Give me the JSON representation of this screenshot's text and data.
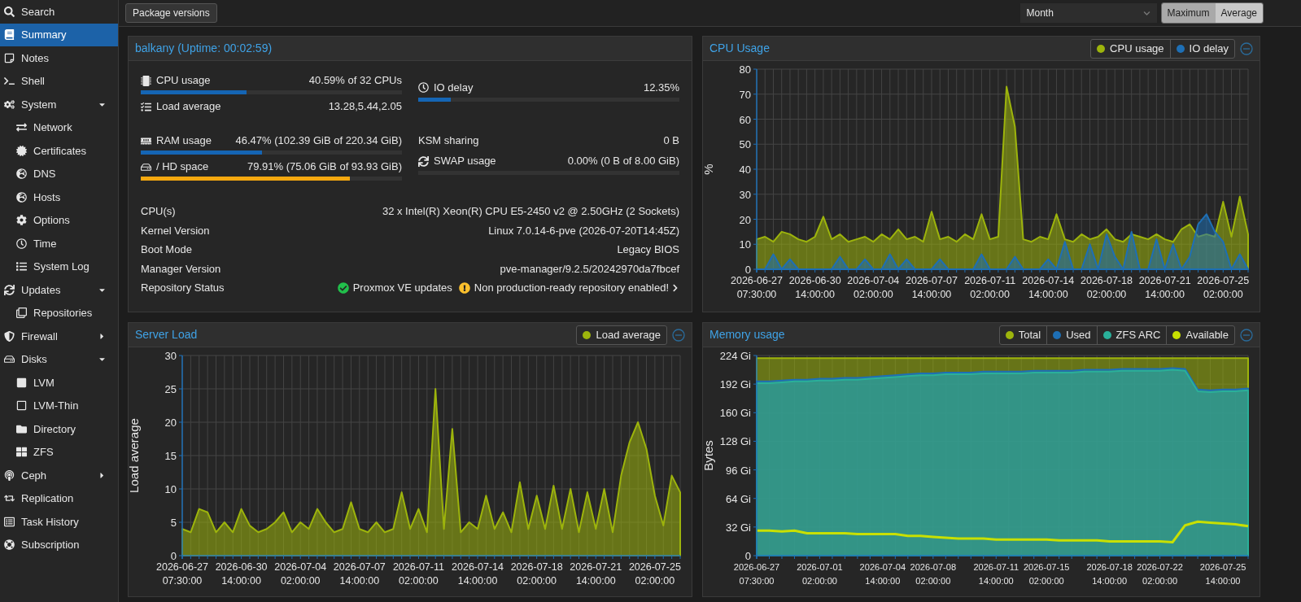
{
  "toolbar": {
    "package_button": "Package versions",
    "timeframe": "Month",
    "modes": [
      {
        "label": "Maximum",
        "selected": true
      },
      {
        "label": "Average",
        "selected": false
      }
    ]
  },
  "sidebar": {
    "items": [
      {
        "label": "Search",
        "selected": false
      },
      {
        "label": "Summary",
        "selected": true
      },
      {
        "label": "Notes",
        "selected": false
      },
      {
        "label": "Shell",
        "selected": false
      },
      {
        "label": "System",
        "selected": false,
        "expanded": true,
        "children": [
          {
            "label": "Network",
            "selected": false
          },
          {
            "label": "Certificates",
            "selected": false
          },
          {
            "label": "DNS",
            "selected": false
          },
          {
            "label": "Hosts",
            "selected": false
          },
          {
            "label": "Options",
            "selected": false
          },
          {
            "label": "Time",
            "selected": false
          },
          {
            "label": "System Log",
            "selected": false
          }
        ]
      },
      {
        "label": "Updates",
        "selected": false,
        "expanded": true,
        "children": [
          {
            "label": "Repositories",
            "selected": false
          }
        ]
      },
      {
        "label": "Firewall",
        "selected": false,
        "expanded": false
      },
      {
        "label": "Disks",
        "selected": false,
        "expanded": true,
        "children": [
          {
            "label": "LVM",
            "selected": false
          },
          {
            "label": "LVM-Thin",
            "selected": false
          },
          {
            "label": "Directory",
            "selected": false
          },
          {
            "label": "ZFS",
            "selected": false
          }
        ]
      },
      {
        "label": "Ceph",
        "selected": false,
        "expanded": false
      },
      {
        "label": "Replication",
        "selected": false
      },
      {
        "label": "Task History",
        "selected": false
      },
      {
        "label": "Subscription",
        "selected": false
      }
    ]
  },
  "summary": {
    "title": "balkany (Uptime: 00:02:59)",
    "metric_groups": [
      {
        "left": [
          {
            "kind": "bar",
            "label": "CPU usage",
            "value": "40.59% of 32 CPUs",
            "level": 0.4059,
            "warning": false
          },
          {
            "kind": "text",
            "label": "Load average",
            "value": "13.28,5.44,2.05"
          }
        ],
        "right": [
          {
            "kind": "bar",
            "label": "IO delay",
            "value": "12.35%",
            "level": 0.1235,
            "warning": false
          }
        ]
      },
      {
        "left": [
          {
            "kind": "bar",
            "label": "RAM usage",
            "value": "46.47% (102.39 GiB of 220.34 GiB)",
            "level": 0.4647,
            "warning": false
          },
          {
            "kind": "bar",
            "label": "/ HD space",
            "value": "79.91% (75.06 GiB of 93.93 GiB)",
            "level": 0.7991,
            "warning": true
          }
        ],
        "right": [
          {
            "kind": "text",
            "label": "KSM sharing",
            "value": "0 B"
          },
          {
            "kind": "bar",
            "label": "SWAP usage",
            "value": "0.00% (0 B of 8.00 GiB)"
          }
        ]
      }
    ],
    "info": [
      {
        "label": "CPU(s)",
        "value": "32 x Intel(R) Xeon(R) CPU E5-2450 v2 @ 2.50GHz (2 Sockets)"
      },
      {
        "label": "Kernel Version",
        "value": "Linux 7.0.14-6-pve (2026-07-20T14:45Z)"
      },
      {
        "label": "Boot Mode",
        "value": "Legacy BIOS"
      },
      {
        "label": "Manager Version",
        "value": "pve-manager/9.2.5/20242970da7fbcef"
      }
    ],
    "repository_status": {
      "label": "Repository Status",
      "entries": [
        {
          "kind": "ok",
          "text": "Proxmox VE updates"
        },
        {
          "kind": "warning",
          "text": "Non production-ready repository enabled!"
        }
      ]
    }
  },
  "cpu_panel": {
    "title": "CPU Usage",
    "chart_data": {
      "type": "area",
      "grid": true,
      "ylabel": "%",
      "ylim": [
        0,
        80
      ],
      "yticks": [
        0,
        10,
        20,
        30,
        40,
        50,
        60,
        70,
        80
      ],
      "categories": [
        "2026-06-27 07:30:00",
        null,
        null,
        null,
        null,
        null,
        null,
        "2026-06-30 14:00:00",
        null,
        null,
        null,
        null,
        null,
        null,
        "2026-07-04 02:00:00",
        null,
        null,
        null,
        null,
        null,
        null,
        "2026-07-07 14:00:00",
        null,
        null,
        null,
        null,
        null,
        null,
        "2026-07-11 02:00:00",
        null,
        null,
        null,
        null,
        null,
        null,
        "2026-07-14 14:00:00",
        null,
        null,
        null,
        null,
        null,
        null,
        "2026-07-18 02:00:00",
        null,
        null,
        null,
        null,
        null,
        null,
        "2026-07-21 14:00:00",
        null,
        null,
        null,
        null,
        null,
        null,
        "2026-07-25 02:00:00",
        null,
        null,
        null
      ],
      "series": [
        {
          "name": "CPU usage",
          "color": "#9db40c",
          "values": [
            12,
            13,
            11,
            15,
            14,
            12,
            11,
            13,
            21,
            12,
            14,
            11,
            12,
            13,
            11,
            14,
            12,
            16,
            12,
            13,
            11,
            23,
            12,
            13,
            11,
            14,
            12,
            22,
            12,
            13,
            73,
            57,
            12,
            11,
            13,
            12,
            22,
            12,
            11,
            14,
            12,
            13,
            16,
            12,
            11,
            14,
            13,
            12,
            14,
            12,
            11,
            16,
            18,
            13,
            14,
            13,
            27,
            13,
            29,
            14
          ]
        },
        {
          "name": "IO delay",
          "color": "#1e6fb5",
          "values": [
            0,
            0,
            6,
            0,
            4,
            0,
            0,
            0,
            0,
            0,
            5,
            0,
            0,
            4,
            0,
            0,
            6,
            0,
            4,
            0,
            0,
            0,
            4,
            0,
            0,
            0,
            0,
            6,
            0,
            0,
            0,
            5,
            0,
            0,
            0,
            4,
            0,
            11,
            0,
            0,
            10,
            0,
            14,
            5,
            0,
            15,
            0,
            0,
            12,
            0,
            10,
            0,
            5,
            18,
            22,
            15,
            11,
            0,
            6,
            0
          ]
        }
      ]
    }
  },
  "load_panel": {
    "title": "Server Load",
    "chart_data": {
      "type": "area",
      "grid": true,
      "ylabel": "Load average",
      "ylim": [
        0,
        30
      ],
      "yticks": [
        0,
        5,
        10,
        15,
        20,
        25,
        30
      ],
      "categories": [
        "2026-06-27 07:30:00",
        null,
        null,
        null,
        null,
        null,
        null,
        "2026-06-30 14:00:00",
        null,
        null,
        null,
        null,
        null,
        null,
        "2026-07-04 02:00:00",
        null,
        null,
        null,
        null,
        null,
        null,
        "2026-07-07 14:00:00",
        null,
        null,
        null,
        null,
        null,
        null,
        "2026-07-11 02:00:00",
        null,
        null,
        null,
        null,
        null,
        null,
        "2026-07-14 14:00:00",
        null,
        null,
        null,
        null,
        null,
        null,
        "2026-07-18 02:00:00",
        null,
        null,
        null,
        null,
        null,
        null,
        "2026-07-21 14:00:00",
        null,
        null,
        null,
        null,
        null,
        null,
        "2026-07-25 02:00:00",
        null,
        null,
        null
      ],
      "series": [
        {
          "name": "Load average",
          "color": "#9db40c",
          "values": [
            4,
            3.5,
            7,
            6.5,
            3.5,
            5,
            3.5,
            7,
            4.5,
            3.5,
            4,
            5,
            6.5,
            3.5,
            5,
            4,
            7,
            5,
            3.5,
            4,
            8,
            4,
            3.5,
            5,
            3.5,
            4,
            9.5,
            4,
            7,
            3.5,
            25,
            4,
            19,
            3.5,
            5,
            4,
            9,
            4,
            6.5,
            3.5,
            11,
            4,
            9,
            4,
            10.5,
            4,
            10,
            3.5,
            9.5,
            4,
            10,
            3.5,
            12,
            17,
            20,
            16,
            9,
            4.5,
            12,
            9.5
          ]
        }
      ]
    }
  },
  "memory_panel": {
    "title": "Memory usage",
    "chart_data": {
      "type": "area",
      "grid": true,
      "ylabel": "Bytes",
      "ylim": [
        0,
        224
      ],
      "yticks": [
        {
          "value": 0,
          "label": "0"
        },
        {
          "value": 32,
          "label": "32 Gi"
        },
        {
          "value": 64,
          "label": "64 Gi"
        },
        {
          "value": 96,
          "label": "96 Gi"
        },
        {
          "value": 128,
          "label": "128 Gi"
        },
        {
          "value": 160,
          "label": "160 Gi"
        },
        {
          "value": 192,
          "label": "192 Gi"
        },
        {
          "value": 224,
          "label": "224 Gi"
        }
      ],
      "categories": [
        "2026-06-27 07:30:00",
        null,
        null,
        null,
        null,
        "2026-07-01 02:00:00",
        null,
        null,
        null,
        null,
        "2026-07-04 14:00:00",
        null,
        null,
        null,
        "2026-07-08 02:00:00",
        null,
        null,
        null,
        null,
        "2026-07-11 14:00:00",
        null,
        null,
        null,
        "2026-07-15 02:00:00",
        null,
        null,
        null,
        null,
        "2026-07-18 14:00:00",
        null,
        null,
        null,
        "2026-07-22 02:00:00",
        null,
        null,
        null,
        null,
        "2026-07-25 14:00:00",
        null,
        null
      ],
      "series": [
        {
          "name": "Total",
          "color": "#9db40c",
          "values": [
            221,
            221,
            221,
            221,
            221,
            221,
            221,
            221,
            221,
            221,
            221,
            221,
            221,
            221,
            221,
            221,
            221,
            221,
            221,
            221,
            221,
            221,
            221,
            221,
            221,
            221,
            221,
            221,
            221,
            221,
            221,
            221,
            221,
            221,
            221,
            221,
            221,
            221,
            221,
            221
          ]
        },
        {
          "name": "Used",
          "color": "#1e6fb5",
          "values": [
            195,
            195,
            196,
            197,
            197,
            198,
            198,
            199,
            199,
            200,
            201,
            202,
            203,
            204,
            204,
            205,
            205,
            205,
            206,
            206,
            206,
            206,
            207,
            207,
            207,
            207,
            208,
            208,
            208,
            209,
            209,
            209,
            209,
            210,
            209,
            186,
            185,
            186,
            186,
            187
          ]
        },
        {
          "name": "ZFS ARC",
          "color": "#2ab09a",
          "values": [
            193,
            193,
            194,
            195,
            195,
            196,
            196,
            197,
            197,
            198,
            199,
            200,
            201,
            202,
            202,
            203,
            203,
            203,
            204,
            204,
            204,
            204,
            205,
            205,
            205,
            205,
            206,
            206,
            206,
            207,
            207,
            207,
            207,
            208,
            207,
            184,
            183,
            184,
            184,
            185
          ]
        },
        {
          "name": "Available",
          "color": "#c8e000",
          "type": "line",
          "values": [
            28,
            28,
            27,
            28,
            25,
            25,
            25,
            25,
            24,
            24,
            24,
            24,
            22,
            22,
            21,
            20,
            19,
            19,
            19,
            18,
            18,
            18,
            18,
            18,
            17,
            17,
            17,
            17,
            16,
            16,
            16,
            16,
            16,
            15,
            34,
            38,
            37,
            36,
            35,
            33
          ]
        }
      ]
    }
  }
}
